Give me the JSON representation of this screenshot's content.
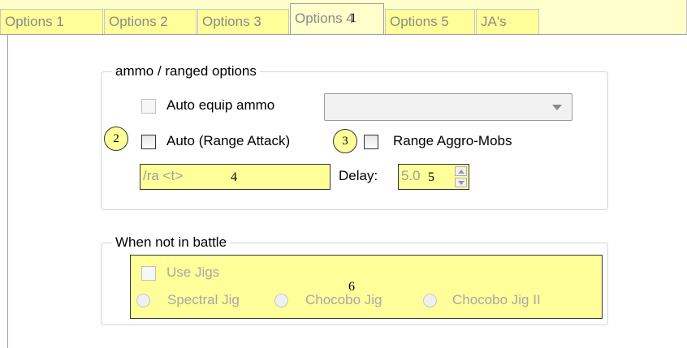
{
  "tabs": [
    {
      "label": "Options 1",
      "active": false
    },
    {
      "label": "Options 2",
      "active": false
    },
    {
      "label": "Options 3",
      "active": false
    },
    {
      "label": "Options 4",
      "active": true
    },
    {
      "label": "Options 5",
      "active": false
    },
    {
      "label": "JA's",
      "active": false
    }
  ],
  "ammo_group": {
    "legend": "ammo / ranged options",
    "auto_equip_ammo": {
      "label": "Auto equip ammo",
      "checked": false,
      "enabled": false
    },
    "ammo_dropdown": {
      "value": "",
      "enabled": false
    },
    "auto_range_attack": {
      "label": "Auto (Range Attack)",
      "checked": false
    },
    "range_aggro_mobs": {
      "label": "Range Aggro-Mobs",
      "checked": false
    },
    "command_input": {
      "value": "/ra <t>"
    },
    "delay": {
      "label": "Delay:",
      "value": "5.0"
    }
  },
  "battle_group": {
    "legend": "When not in battle",
    "use_jigs": {
      "label": "Use Jigs",
      "checked": false,
      "enabled": false
    },
    "jig_options": [
      "Spectral Jig",
      "Chocobo Jig",
      "Chocobo Jig II"
    ]
  },
  "callouts": [
    "1",
    "2",
    "3",
    "4",
    "5",
    "6"
  ],
  "colors": {
    "highlight": "#ffff99",
    "tabstrip": "#ffffcc"
  }
}
